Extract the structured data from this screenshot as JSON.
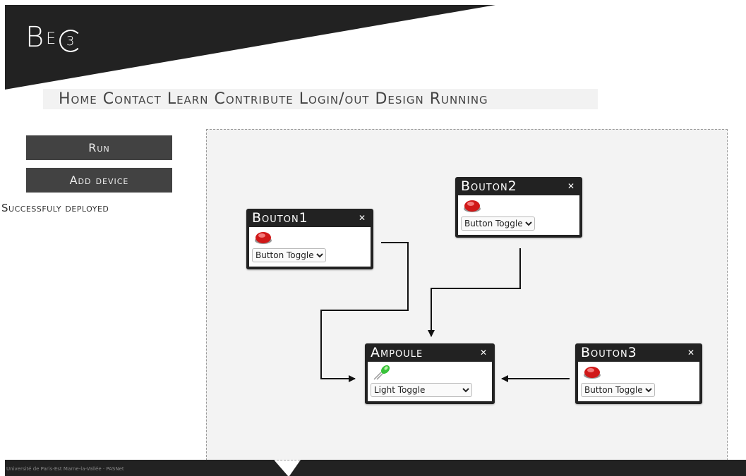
{
  "logo": {
    "b": "B",
    "e": "E",
    "c": "3"
  },
  "nav": [
    "Home",
    "Contact",
    "Learn",
    "Contribute",
    "Login/out",
    "Design",
    "Running"
  ],
  "sidebar": {
    "run_label": "Run",
    "add_device_label": "Add device",
    "status": "Successfuly deployed"
  },
  "devices": {
    "bouton1": {
      "title": "Bouton1",
      "close": "✕",
      "select": [
        "Button Toggle"
      ],
      "icon": "red-button-icon"
    },
    "bouton2": {
      "title": "Bouton2",
      "close": "✕",
      "select": [
        "Button Toggle"
      ],
      "icon": "red-button-icon"
    },
    "bouton3": {
      "title": "Bouton3",
      "close": "✕",
      "select": [
        "Button Toggle"
      ],
      "icon": "red-button-icon"
    },
    "ampoule": {
      "title": "Ampoule",
      "close": "✕",
      "select": [
        "Light Toggle"
      ],
      "icon": "green-led-icon"
    }
  },
  "footer": {
    "text": "Université de Paris-Est Marne-la-Vallée · PASNet"
  },
  "colors": {
    "dark": "#222222",
    "button": "#424242",
    "canvas": "#f3f3f3"
  }
}
